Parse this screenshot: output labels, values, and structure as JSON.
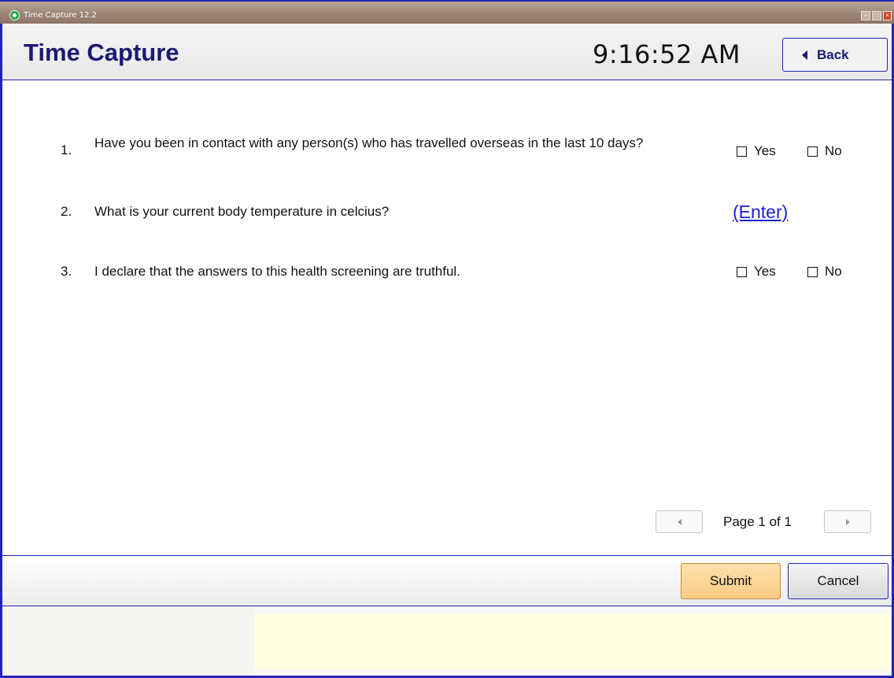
{
  "window": {
    "title": "Time Capture 12.2",
    "colors": {
      "frame": "#2323b5",
      "close": "#d24a2c",
      "brand_title": "#1a1a74",
      "link": "#1b1be0",
      "submit": "#fbcb84"
    }
  },
  "header": {
    "title": "Time Capture",
    "clock": "9:16:52 AM",
    "back_label": "Back"
  },
  "questions": [
    {
      "number": "1.",
      "text": "Have you been in contact with any person(s) who has travelled overseas in the last 10 days?",
      "options": [
        "Yes",
        "No"
      ]
    },
    {
      "number": "2.",
      "text": "What is your current body temperature in celcius?",
      "link": "(Enter)"
    },
    {
      "number": "3.",
      "text": "I declare that the answers to this health screening are truthful.",
      "options": [
        "Yes",
        "No"
      ]
    }
  ],
  "pager": {
    "label": "Page 1 of 1"
  },
  "footer": {
    "submit_label": "Submit",
    "cancel_label": "Cancel"
  }
}
